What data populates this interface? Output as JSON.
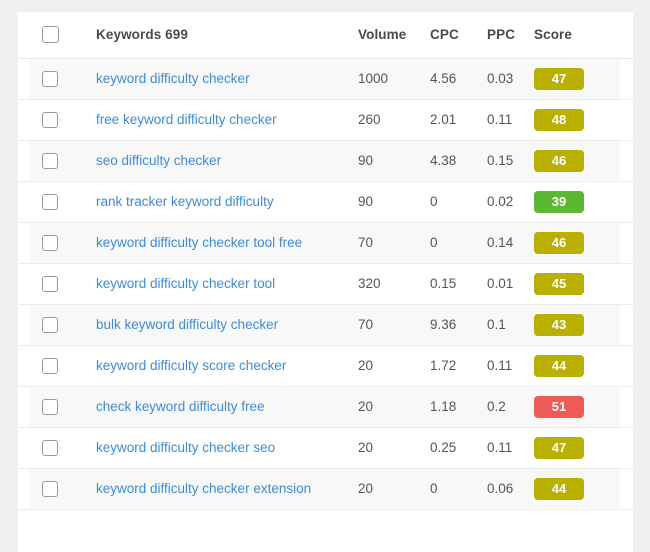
{
  "table": {
    "columns": [
      {
        "key": "checkbox",
        "label": ""
      },
      {
        "key": "keyword",
        "label": "Keywords 699"
      },
      {
        "key": "volume",
        "label": "Volume"
      },
      {
        "key": "cpc",
        "label": "CPC"
      },
      {
        "key": "ppc",
        "label": "PPC"
      },
      {
        "key": "score",
        "label": "Score"
      }
    ],
    "select_all_checked": false,
    "rows": [
      {
        "keyword": "keyword difficulty checker",
        "volume": "1000",
        "cpc": "4.56",
        "ppc": "0.03",
        "score": "47",
        "score_color": "#b9b000",
        "checked": false
      },
      {
        "keyword": "free keyword difficulty checker",
        "volume": "260",
        "cpc": "2.01",
        "ppc": "0.11",
        "score": "48",
        "score_color": "#b9b000",
        "checked": false
      },
      {
        "keyword": "seo difficulty checker",
        "volume": "90",
        "cpc": "4.38",
        "ppc": "0.15",
        "score": "46",
        "score_color": "#b9b000",
        "checked": false
      },
      {
        "keyword": "rank tracker keyword difficulty",
        "volume": "90",
        "cpc": "0",
        "ppc": "0.02",
        "score": "39",
        "score_color": "#5cb832",
        "checked": false
      },
      {
        "keyword": "keyword difficulty checker tool free",
        "volume": "70",
        "cpc": "0",
        "ppc": "0.14",
        "score": "46",
        "score_color": "#b9b000",
        "checked": false
      },
      {
        "keyword": "keyword difficulty checker tool",
        "volume": "320",
        "cpc": "0.15",
        "ppc": "0.01",
        "score": "45",
        "score_color": "#b9b000",
        "checked": false
      },
      {
        "keyword": "bulk keyword difficulty checker",
        "volume": "70",
        "cpc": "9.36",
        "ppc": "0.1",
        "score": "43",
        "score_color": "#b9b000",
        "checked": false
      },
      {
        "keyword": "keyword difficulty score checker",
        "volume": "20",
        "cpc": "1.72",
        "ppc": "0.11",
        "score": "44",
        "score_color": "#b9b000",
        "checked": false
      },
      {
        "keyword": "check keyword difficulty free",
        "volume": "20",
        "cpc": "1.18",
        "ppc": "0.2",
        "score": "51",
        "score_color": "#ee5a56",
        "checked": false
      },
      {
        "keyword": "keyword difficulty checker seo",
        "volume": "20",
        "cpc": "0.25",
        "ppc": "0.11",
        "score": "47",
        "score_color": "#b9b000",
        "checked": false
      },
      {
        "keyword": "keyword difficulty checker extension",
        "volume": "20",
        "cpc": "0",
        "ppc": "0.06",
        "score": "44",
        "score_color": "#b9b000",
        "checked": false
      }
    ]
  },
  "colors": {
    "link": "#3d8bd6",
    "score_medium": "#b9b000",
    "score_low": "#5cb832",
    "score_high": "#ee5a56",
    "page_background": "#f0f0f0",
    "card_background": "#ffffff",
    "row_alt_background": "#f8f8f8"
  }
}
